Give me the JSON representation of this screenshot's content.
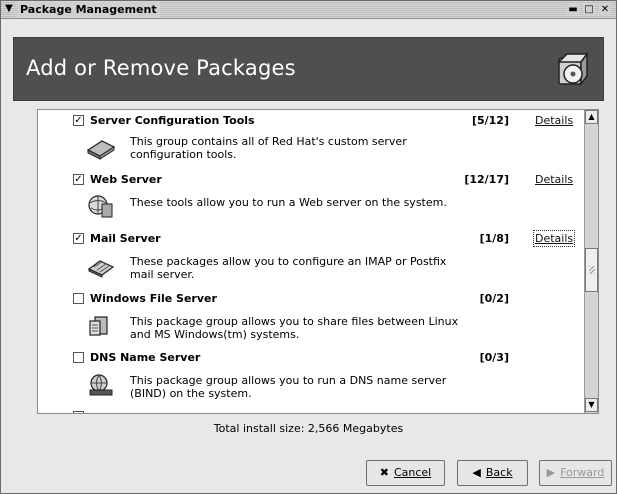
{
  "window": {
    "title": "Package Management",
    "menu_glyph": "▼",
    "minimize_glyph": "▬",
    "maximize_glyph": "□",
    "close_glyph": "✕"
  },
  "header": {
    "title": "Add or Remove Packages",
    "icon": "package-install-icon"
  },
  "groups": [
    {
      "name": "Server Configuration Tools",
      "checked": true,
      "count": "[5/12]",
      "details_label": "Details",
      "icon": "server-config-icon",
      "description": [
        "This group contains all of Red Hat's custom server",
        "configuration tools."
      ]
    },
    {
      "name": "Web Server",
      "checked": true,
      "count": "[12/17]",
      "details_label": "Details",
      "icon": "web-server-icon",
      "description": [
        "These tools allow you to run a Web server on the system."
      ]
    },
    {
      "name": "Mail Server",
      "checked": true,
      "count": "[1/8]",
      "details_label": "Details",
      "icon": "mail-server-icon",
      "description": [
        "These packages allow you to configure an IMAP or Postfix",
        "mail server."
      ]
    },
    {
      "name": "Windows File Server",
      "checked": false,
      "count": "[0/2]",
      "icon": "windows-file-server-icon",
      "description": [
        "This package group allows you to share files between Linux",
        "and MS Windows(tm) systems."
      ]
    },
    {
      "name": "DNS Name Server",
      "checked": false,
      "count": "[0/3]",
      "icon": "dns-server-icon",
      "description": [
        "This package group allows you to run a DNS name server",
        "(BIND) on the system."
      ]
    }
  ],
  "total_install": "Total install size: 2,566 Megabytes",
  "buttons": {
    "cancel": {
      "label": "Cancel",
      "icon": "cancel-icon"
    },
    "back": {
      "label": "Back",
      "icon": "back-arrow-icon"
    },
    "forward": {
      "label": "Forward",
      "icon": "forward-arrow-icon",
      "disabled": true
    }
  },
  "colors": {
    "banner": "#4f4f4f",
    "window_bg": "#e8e8e8"
  }
}
